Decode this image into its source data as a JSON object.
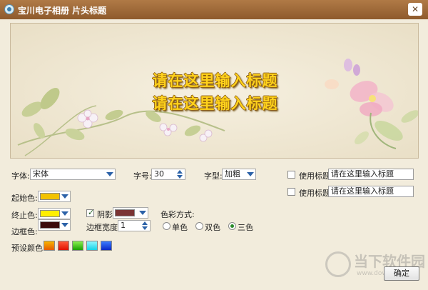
{
  "window": {
    "title": "宝川电子相册 片头标题",
    "close_glyph": "✕"
  },
  "preview": {
    "line1": "请在这里输入标题",
    "line2": "请在这里输入标题"
  },
  "font": {
    "label": "字体:",
    "value": "宋体"
  },
  "size": {
    "label": "字号:",
    "value": "30"
  },
  "style": {
    "label": "字型:",
    "value": "加粗"
  },
  "titles": [
    {
      "checkbox_label": "使用标题",
      "checked": false,
      "value": "请在这里输入标题"
    },
    {
      "checkbox_label": "使用标题",
      "checked": false,
      "value": "请在这里输入标题"
    }
  ],
  "start_color": {
    "label": "起始色:",
    "color": "#f2c200"
  },
  "end_color": {
    "label": "终止色:",
    "color": "#ffef00"
  },
  "shadow": {
    "label": "阴影",
    "checked": true,
    "color": "#7b3434"
  },
  "border_color": {
    "label": "边框色:",
    "color": "#3a0b0b"
  },
  "border_width": {
    "label": "边框宽度:",
    "value": "1"
  },
  "color_mode": {
    "label": "色彩方式:",
    "options": [
      "单色",
      "双色",
      "三色"
    ],
    "selected": "三色"
  },
  "presets": {
    "label": "预设颜色:",
    "colors": [
      "#f07a00",
      "#ff2a00",
      "#3ac800",
      "#29e3ef",
      "#0a3ee0"
    ]
  },
  "ok_label": "确定",
  "watermark": {
    "text": "当下软件园",
    "url": "www.downxia.com"
  },
  "colors": {
    "titlebar": "#9a6636",
    "window_bg": "#f2ecdc",
    "headline_fill": "#ffd21c"
  }
}
